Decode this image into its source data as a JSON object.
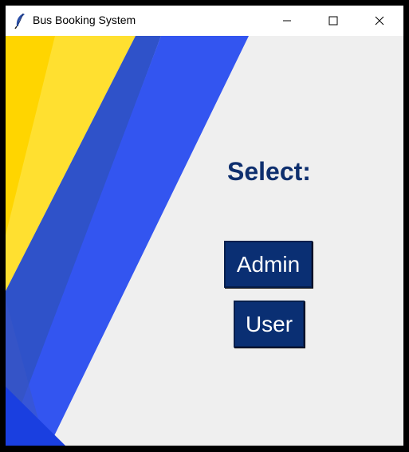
{
  "window": {
    "title": "Bus Booking System",
    "app_icon": "feather-icon",
    "controls": {
      "minimize": "minimize-icon",
      "maximize": "maximize-icon",
      "close": "close-icon"
    }
  },
  "main": {
    "heading": "Select:",
    "buttons": {
      "admin_label": "Admin",
      "user_label": "User"
    }
  },
  "colors": {
    "accent_blue": "#3355f0",
    "accent_yellow": "#ffd80a",
    "button_bg": "#0a2f73",
    "heading_text": "#0e2f6e",
    "background": "#efefef"
  }
}
